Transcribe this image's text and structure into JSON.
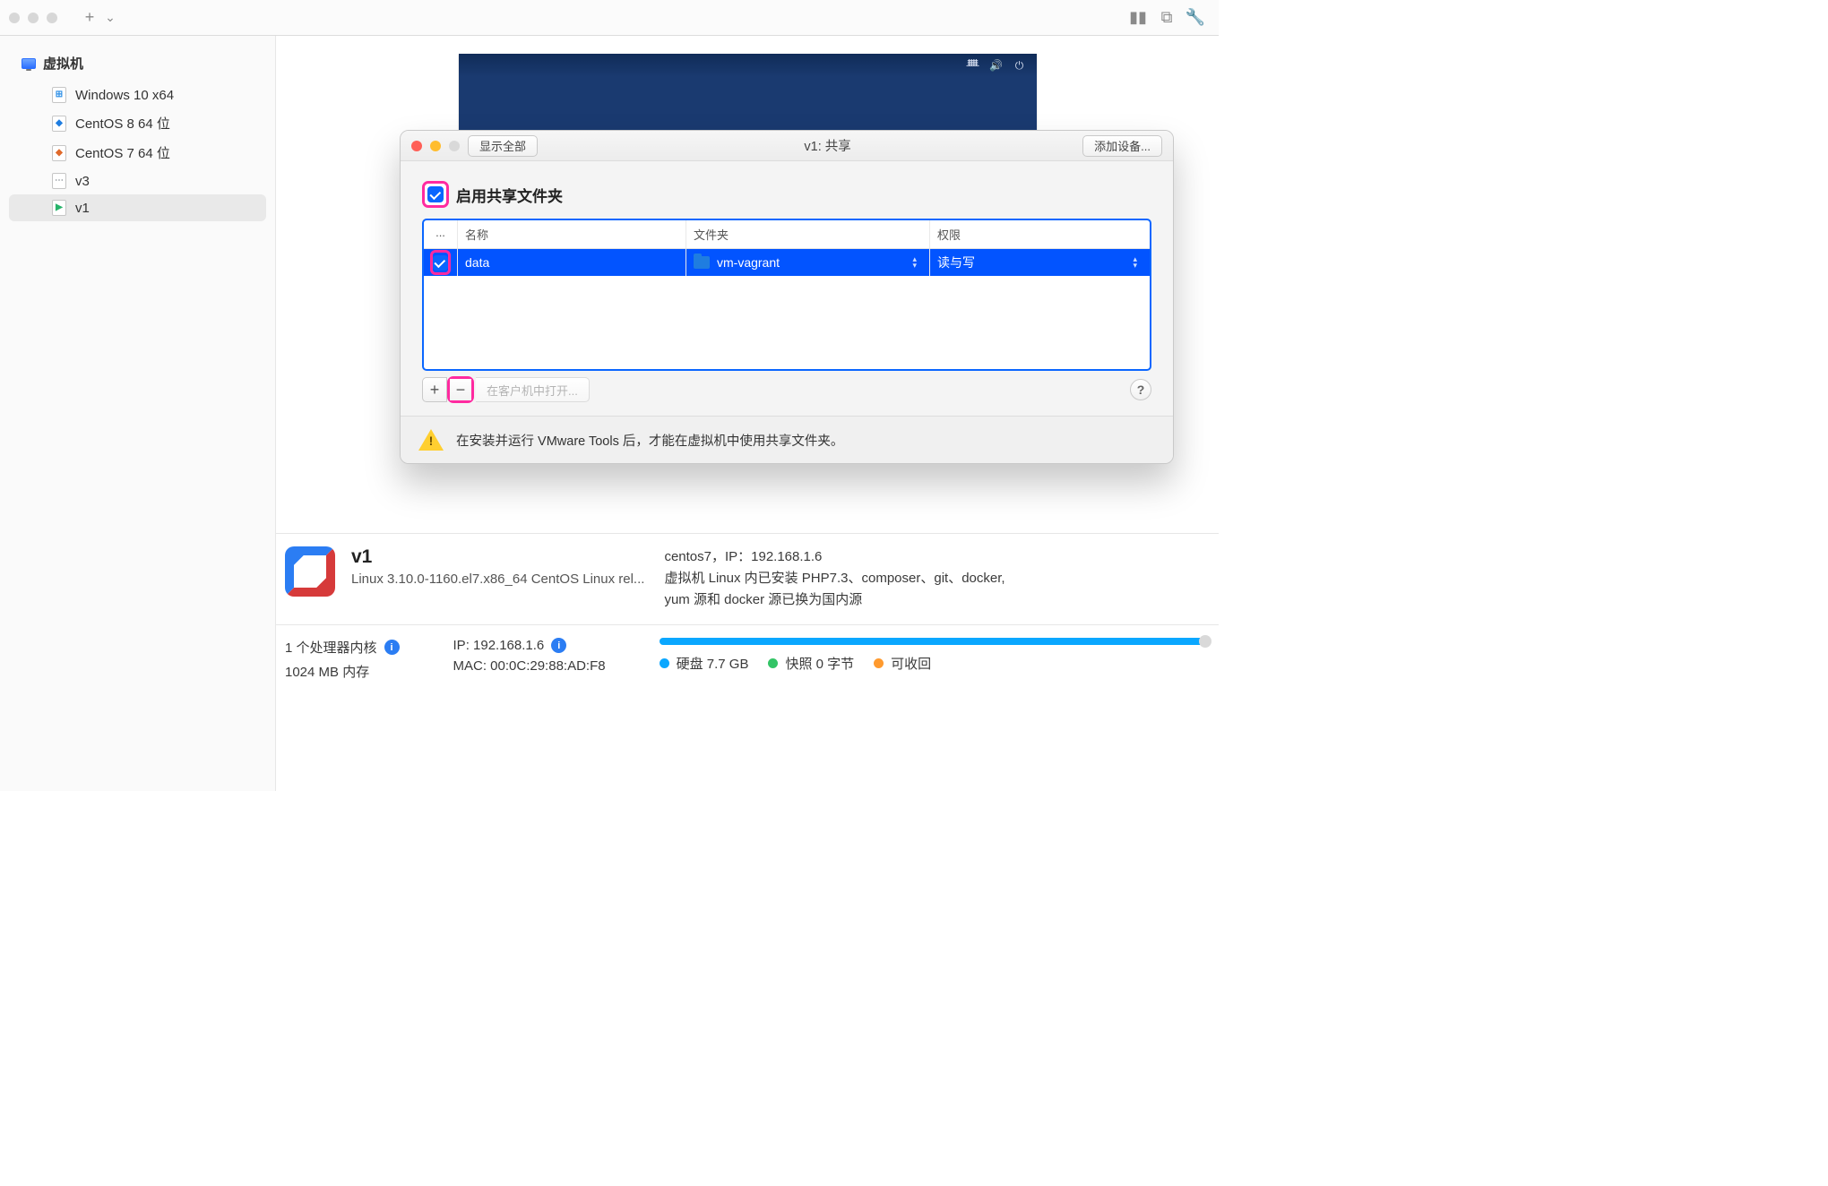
{
  "toolbar": {
    "plus": "+",
    "caret": "⌄"
  },
  "sidebar": {
    "header": "虚拟机",
    "items": [
      {
        "label": "Windows 10 x64",
        "glyphcls": "glyph-win",
        "glyph": "⊞",
        "selected": false
      },
      {
        "label": "CentOS 8 64 位",
        "glyphcls": "glyph-cent8",
        "glyph": "◆",
        "selected": false
      },
      {
        "label": "CentOS 7 64 位",
        "glyphcls": "glyph-cent7",
        "glyph": "◆",
        "selected": false
      },
      {
        "label": "v3",
        "glyphcls": "glyph-v3",
        "glyph": "⋯",
        "selected": false
      },
      {
        "label": "v1",
        "glyphcls": "glyph-v1",
        "glyph": "▶",
        "selected": true
      }
    ]
  },
  "sheet": {
    "show_all": "显示全部",
    "title": "v1: 共享",
    "add_device": "添加设备...",
    "enable_label": "启用共享文件夹",
    "columns": {
      "on": "...",
      "name": "名称",
      "folder": "文件夹",
      "perm": "权限"
    },
    "rows": [
      {
        "on": true,
        "name": "data",
        "folder": "vm-vagrant",
        "perm": "读与写",
        "selected": true
      }
    ],
    "add": "+",
    "remove": "−",
    "open_in_guest": "在客户机中打开...",
    "help": "?",
    "warning": "在安装并运行 VMware Tools 后，才能在虚拟机中使用共享文件夹。"
  },
  "summary": {
    "name": "v1",
    "subtitle": "Linux 3.10.0-1160.el7.x86_64 CentOS Linux rel...",
    "desc1": "centos7，IP：192.168.1.6",
    "desc2": "虚拟机 Linux 内已安装 PHP7.3、composer、git、docker,",
    "desc3": "yum 源和 docker 源已换为国内源"
  },
  "stats": {
    "cpu": "1 个处理器内核",
    "mem": "1024 MB 内存",
    "ip_label": "IP: 192.168.1.6",
    "mac_label": "MAC: 00:0C:29:88:AD:F8",
    "disk": "硬盘  7.7 GB",
    "snapshot": "快照  0 字节",
    "reclaim": "可收回"
  }
}
